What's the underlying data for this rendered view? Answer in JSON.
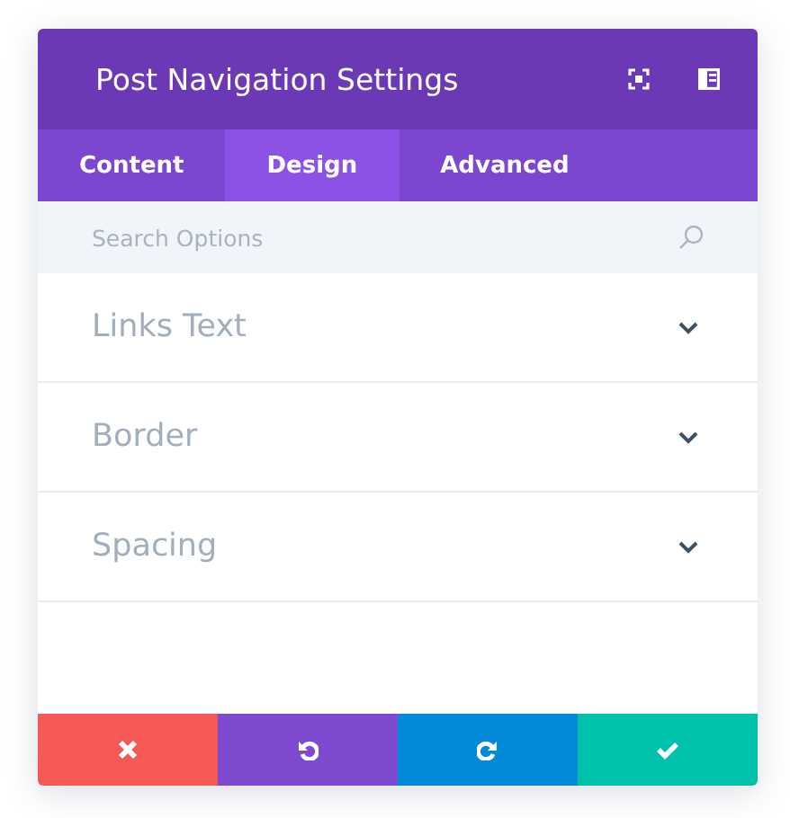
{
  "window": {
    "title": "Post Navigation Settings"
  },
  "tabs": [
    {
      "label": "Content",
      "selected": false
    },
    {
      "label": "Design",
      "selected": true
    },
    {
      "label": "Advanced",
      "selected": false
    }
  ],
  "search": {
    "placeholder": "Search Options"
  },
  "sections": [
    {
      "label": "Links Text",
      "expanded": false
    },
    {
      "label": "Border",
      "expanded": false
    },
    {
      "label": "Spacing",
      "expanded": false
    }
  ],
  "footer_buttons": [
    {
      "kind": "cancel"
    },
    {
      "kind": "undo"
    },
    {
      "kind": "redo"
    },
    {
      "kind": "save"
    }
  ]
}
